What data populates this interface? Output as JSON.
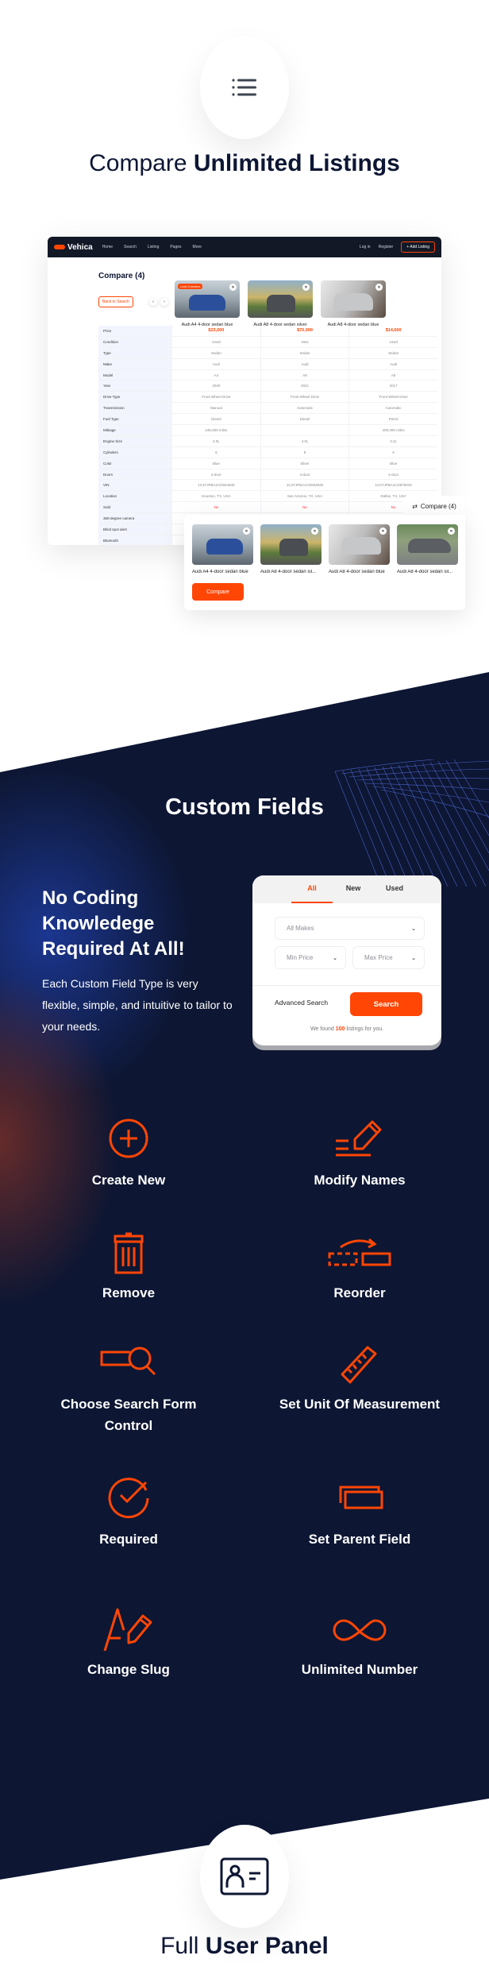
{
  "compare_section": {
    "icon": "list-icon",
    "title_light": "Compare",
    "title_bold": "Unlimited Listings"
  },
  "mock_site": {
    "logo": "Vehica",
    "nav": [
      "Home",
      "Search",
      "Listing",
      "Pages",
      "More"
    ],
    "login": "Log in",
    "register": "Register",
    "add_listing": "+ Add Listing",
    "page_title": "Compare (4)",
    "back_button": "Back to Search",
    "lock_columns": "Lock Columns",
    "cars": [
      {
        "name": "Audi A4 4-door sedan blue"
      },
      {
        "name": "Audi A8 4-door sedan silver"
      },
      {
        "name": "Audi A8 4-door sedan blue"
      }
    ],
    "table": [
      {
        "label": "Price",
        "values": [
          "$23,000",
          "$70,000",
          "$14,600"
        ],
        "kind": "price"
      },
      {
        "label": "Condition",
        "values": [
          "Used",
          "New",
          "Used"
        ]
      },
      {
        "label": "Type",
        "values": [
          "Sedan",
          "Sedan",
          "Sedan"
        ]
      },
      {
        "label": "Make",
        "values": [
          "Audi",
          "Audi",
          "Audi"
        ]
      },
      {
        "label": "Model",
        "values": [
          "A4",
          "A8",
          "A8"
        ]
      },
      {
        "label": "Year",
        "values": [
          "2020",
          "2021",
          "2017"
        ]
      },
      {
        "label": "Drive Type",
        "values": [
          "Front Wheel Drive",
          "Front Wheel Drive",
          "Front Wheel Drive"
        ]
      },
      {
        "label": "Transmission",
        "values": [
          "Manual",
          "Automatic",
          "Automatic"
        ]
      },
      {
        "label": "Fuel Type",
        "values": [
          "Diesel",
          "Diesel",
          "Petrol"
        ]
      },
      {
        "label": "Mileage",
        "values": [
          "245,000 miles",
          "",
          "400,000 miles"
        ]
      },
      {
        "label": "Engine Size",
        "values": [
          "2.0L",
          "4.0L",
          "3.2L"
        ]
      },
      {
        "label": "Cylinders",
        "values": [
          "6",
          "8",
          "6"
        ]
      },
      {
        "label": "Color",
        "values": [
          "Blue",
          "Silver",
          "Blue"
        ]
      },
      {
        "label": "Doors",
        "values": [
          "4-door",
          "4-door",
          "4-door"
        ]
      },
      {
        "label": "VIN",
        "values": [
          "1C4TJPBA1CD504639",
          "1C4TJPBA1CD603030",
          "1C4TJPBA1CD876040"
        ]
      },
      {
        "label": "Location",
        "values": [
          "Houston, TX, USA",
          "San Antonio, TX, USA",
          "Dallas, TX, USA"
        ]
      },
      {
        "label": "Sold",
        "values": [
          "No",
          "No",
          "No"
        ],
        "kind": "red"
      },
      {
        "label": "360-degree camera",
        "values": [
          "",
          "",
          ""
        ]
      },
      {
        "label": "Blind spot alert",
        "values": [
          "",
          "",
          ""
        ]
      },
      {
        "label": "Bluetooth",
        "values": [
          "",
          "",
          ""
        ]
      }
    ]
  },
  "compare_panel": {
    "tab_label": "Compare (4)",
    "cars": [
      "Audi A4 4-door sedan blue",
      "Audi A8 4-door sedan sil...",
      "Audi A8 4-door sedan blue",
      "Audi A8 4-door sedan sil..."
    ],
    "compare_button": "Compare"
  },
  "custom_fields": {
    "title": "Custom Fields",
    "heading": "No Coding Knowledege Required At All!",
    "description": "Each Custom Field Type is very flexible, simple, and intuitive to tailor to your needs.",
    "search_widget": {
      "tabs": [
        "All",
        "New",
        "Used"
      ],
      "active_tab": "All",
      "make_placeholder": "All Makes",
      "min_price_placeholder": "Min Price",
      "max_price_placeholder": "Max Price",
      "advanced_search": "Advanced Search",
      "search_button": "Search",
      "found_prefix": "We found",
      "found_count": "100",
      "found_suffix": "listings for you."
    },
    "features": [
      {
        "label": "Create New",
        "icon": "plus-circle-icon"
      },
      {
        "label": "Modify Names",
        "icon": "pencil-lines-icon"
      },
      {
        "label": "Remove",
        "icon": "trash-icon"
      },
      {
        "label": "Reorder",
        "icon": "reorder-icon"
      },
      {
        "label": "Choose Search Form Control",
        "icon": "search-field-icon"
      },
      {
        "label": "Set Unit Of Measurement",
        "icon": "ruler-icon"
      },
      {
        "label": "Required",
        "icon": "check-circle-icon"
      },
      {
        "label": "Set Parent Field",
        "icon": "stacked-fields-icon"
      },
      {
        "label": "Change Slug",
        "icon": "text-edit-icon"
      },
      {
        "label": "Unlimited Number",
        "icon": "infinity-icon"
      }
    ]
  },
  "user_panel_section": {
    "icon": "id-card-icon",
    "title_light": "Full",
    "title_bold": "User Panel"
  },
  "colors": {
    "accent": "#ff4605",
    "dark_bg": "#0d1633",
    "title_text": "#0d1633"
  }
}
